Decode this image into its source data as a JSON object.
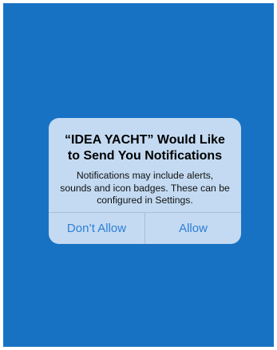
{
  "alert": {
    "title": "“IDEA YACHT” Would Like to Send You Notifications",
    "message": "Notifications may include alerts, sounds and icon badges. These can be configured in Settings.",
    "buttons": {
      "dont_allow": "Don’t Allow",
      "allow": "Allow"
    }
  },
  "colors": {
    "background": "#1872c4",
    "dialog": "#c3daf2",
    "button_text": "#2f7fd6"
  }
}
